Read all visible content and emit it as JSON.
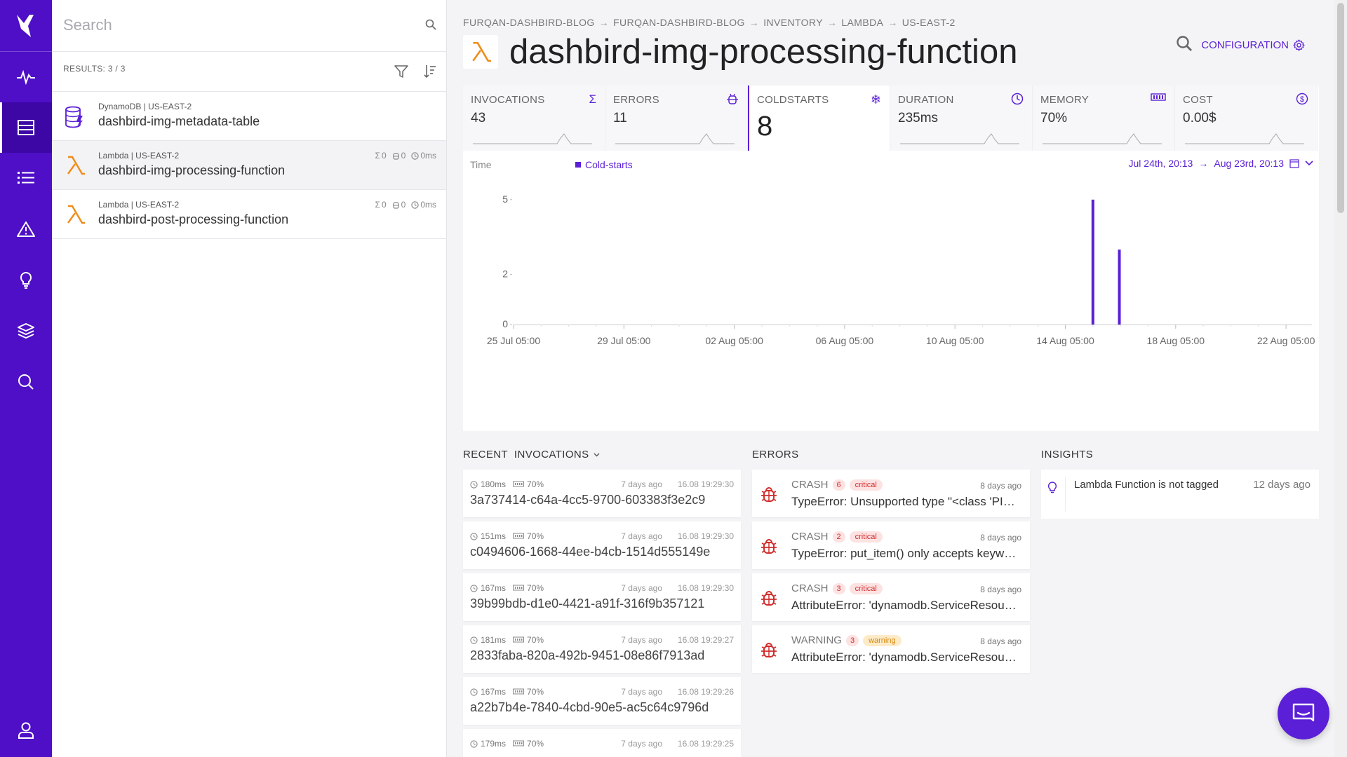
{
  "colors": {
    "brand": "#4e0fc7",
    "accent": "#5a1fd6",
    "lambda": "#f08c1a",
    "error": "#d12c2c"
  },
  "nav": {
    "items": [
      "activity-icon",
      "inventory-icon",
      "list-icon",
      "alert-icon",
      "insights-icon",
      "layers-icon",
      "search-icon",
      "user-icon"
    ]
  },
  "search": {
    "placeholder": "Search",
    "results_label": "RESULTS: 3 / 3"
  },
  "resources": [
    {
      "meta": "DynamoDB | US-EAST-2",
      "name": "dashbird-img-metadata-table",
      "icon": "dynamodb-icon"
    },
    {
      "meta": "Lambda | US-EAST-2",
      "name": "dashbird-img-processing-function",
      "icon": "lambda-icon",
      "invocations": "0",
      "errors": "0",
      "duration": "0ms"
    },
    {
      "meta": "Lambda | US-EAST-2",
      "name": "dashbird-post-processing-function",
      "icon": "lambda-icon",
      "invocations": "0",
      "errors": "0",
      "duration": "0ms"
    }
  ],
  "breadcrumb": [
    "FURQAN-DASHBIRD-BLOG",
    "FURQAN-DASHBIRD-BLOG",
    "INVENTORY",
    "LAMBDA",
    "US-EAST-2"
  ],
  "page_title": "dashbird-img-processing-function",
  "configuration_label": "CONFIGURATION",
  "metrics": [
    {
      "label": "INVOCATIONS",
      "value": "43",
      "icon": "sigma-icon"
    },
    {
      "label": "ERRORS",
      "value": "11",
      "icon": "bug-icon"
    },
    {
      "label": "COLDSTARTS",
      "value": "8",
      "icon": "snowflake-icon"
    },
    {
      "label": "DURATION",
      "value": "235ms",
      "icon": "clock-icon"
    },
    {
      "label": "MEMORY",
      "value": "70%",
      "icon": "memory-icon"
    },
    {
      "label": "COST",
      "value": "0.00$",
      "icon": "dollar-icon"
    }
  ],
  "chart": {
    "time_label": "Time",
    "legend": "Cold-starts",
    "range_from": "Jul 24th, 20:13",
    "range_to": "Aug 23rd, 20:13"
  },
  "chart_data": {
    "type": "bar",
    "series": [
      {
        "name": "Cold-starts",
        "points": [
          {
            "x": "15 Aug 05:00",
            "y": 5
          },
          {
            "x": "16 Aug 04:00",
            "y": 3
          }
        ]
      }
    ],
    "x_ticks": [
      "25 Jul 05:00",
      "29 Jul 05:00",
      "02 Aug 05:00",
      "06 Aug 05:00",
      "10 Aug 05:00",
      "14 Aug 05:00",
      "18 Aug 05:00",
      "22 Aug 05:00"
    ],
    "y_ticks": [
      "0",
      "2",
      "5"
    ],
    "ylim": [
      0,
      5.5
    ]
  },
  "sections": {
    "invocations": "RECENT  INVOCATIONS",
    "errors": "ERRORS",
    "insights": "INSIGHTS"
  },
  "invocations": [
    {
      "duration": "180ms",
      "memory": "70%",
      "ago": "7 days ago",
      "date": "16.08 19:29:30",
      "id": "3a737414-c64a-4cc5-9700-603383f3e2c9"
    },
    {
      "duration": "151ms",
      "memory": "70%",
      "ago": "7 days ago",
      "date": "16.08 19:29:30",
      "id": "c0494606-1668-44ee-b4cb-1514d555149e"
    },
    {
      "duration": "167ms",
      "memory": "70%",
      "ago": "7 days ago",
      "date": "16.08 19:29:30",
      "id": "39b99bdb-d1e0-4421-a91f-316f9b357121"
    },
    {
      "duration": "181ms",
      "memory": "70%",
      "ago": "7 days ago",
      "date": "16.08 19:29:27",
      "id": "2833faba-820a-492b-9451-08e86f7913ad"
    },
    {
      "duration": "167ms",
      "memory": "70%",
      "ago": "7 days ago",
      "date": "16.08 19:29:26",
      "id": "a22b7b4e-7840-4cbd-90e5-ac5c64c9796d"
    },
    {
      "duration": "179ms",
      "memory": "70%",
      "ago": "7 days ago",
      "date": "16.08 19:29:25",
      "id": ""
    }
  ],
  "errors": [
    {
      "type": "CRASH",
      "count": "6",
      "severity": "critical",
      "ago": "8 days ago",
      "message": "TypeError: Unsupported type \"<class 'PIL.Image.Image'>\""
    },
    {
      "type": "CRASH",
      "count": "2",
      "severity": "critical",
      "ago": "8 days ago",
      "message": "TypeError: put_item() only accepts keyword arguments."
    },
    {
      "type": "CRASH",
      "count": "3",
      "severity": "critical",
      "ago": "8 days ago",
      "message": "AttributeError: 'dynamodb.ServiceResource' object"
    },
    {
      "type": "WARNING",
      "count": "3",
      "severity": "warning",
      "ago": "8 days ago",
      "message": "AttributeError: 'dynamodb.ServiceResource' object"
    }
  ],
  "insights": [
    {
      "message": "Lambda Function is not tagged",
      "ago": "12 days ago"
    }
  ]
}
